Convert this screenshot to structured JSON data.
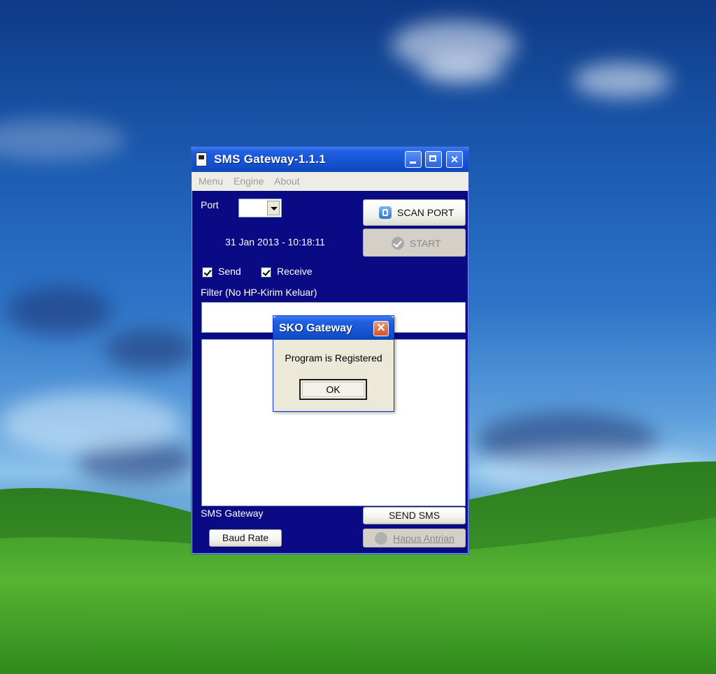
{
  "window": {
    "title": "SMS Gateway-1.1.1",
    "menu": [
      "Menu",
      "Engine",
      "About"
    ],
    "port_label": "Port",
    "port_value": "",
    "datetime": "31 Jan 2013 - 10:18:11",
    "scan_port_label": "SCAN PORT",
    "start_label": "START",
    "send_label": "Send",
    "send_checked": true,
    "receive_label": "Receive",
    "receive_checked": true,
    "filter_label": "Filter (No HP-Kirim Keluar)",
    "filter_value": "",
    "status_label": "SMS Gateway",
    "send_sms_label": "SEND SMS",
    "baud_rate_label": "Baud Rate",
    "hapus_antrian_label": "Hapus Antrian",
    "icons": [
      "app-icon",
      "minimize-icon",
      "maximize-icon",
      "close-icon",
      "scan-icon",
      "check-circle-icon",
      "dropdown-arrow-icon"
    ]
  },
  "dialog": {
    "title": "SKO Gateway",
    "message": "Program is Registered",
    "ok_label": "OK"
  },
  "colors": {
    "window_body": "#0a0a84",
    "titlebar": "#1553d2",
    "menubar": "#eeede5",
    "dialog_bg": "#ece9d8",
    "dialog_close": "#d2512b"
  }
}
